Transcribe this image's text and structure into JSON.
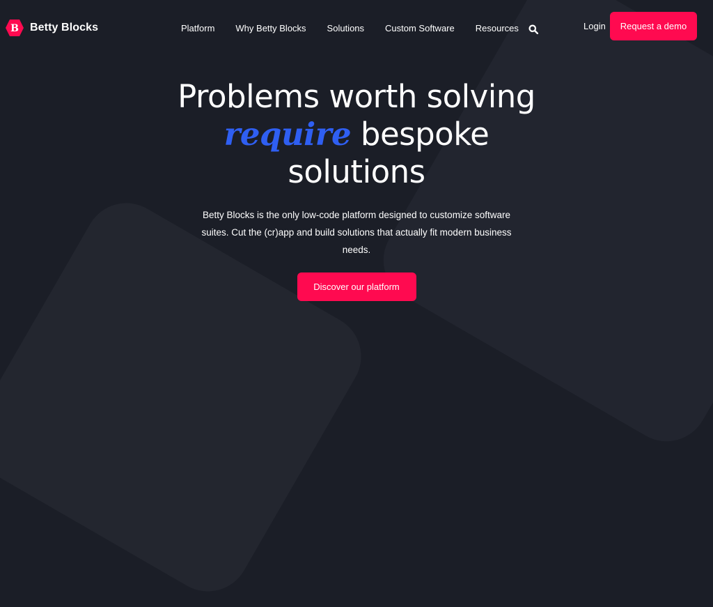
{
  "brand": {
    "name": "Betty Blocks",
    "logo_letter": "B",
    "color": "#ff0a50"
  },
  "nav": {
    "items": [
      {
        "label": "Platform"
      },
      {
        "label": "Why Betty Blocks"
      },
      {
        "label": "Solutions"
      },
      {
        "label": "Custom Software"
      },
      {
        "label": "Resources"
      }
    ],
    "search_icon": "search-icon",
    "login_label": "Login",
    "demo_label": "Request a demo"
  },
  "hero": {
    "title_line1": "Problems worth solving",
    "title_accent": "require",
    "title_line2_rest": "bespoke",
    "title_line3": "solutions",
    "accent_color": "#2f5ff2",
    "subtitle": "Betty Blocks is the only low-code platform designed to customize software suites. Cut the (cr)app and build solutions that actually fit modern business needs.",
    "cta_label": "Discover our platform"
  },
  "colors": {
    "background": "#1b1e27",
    "button": "#ff0a50"
  }
}
